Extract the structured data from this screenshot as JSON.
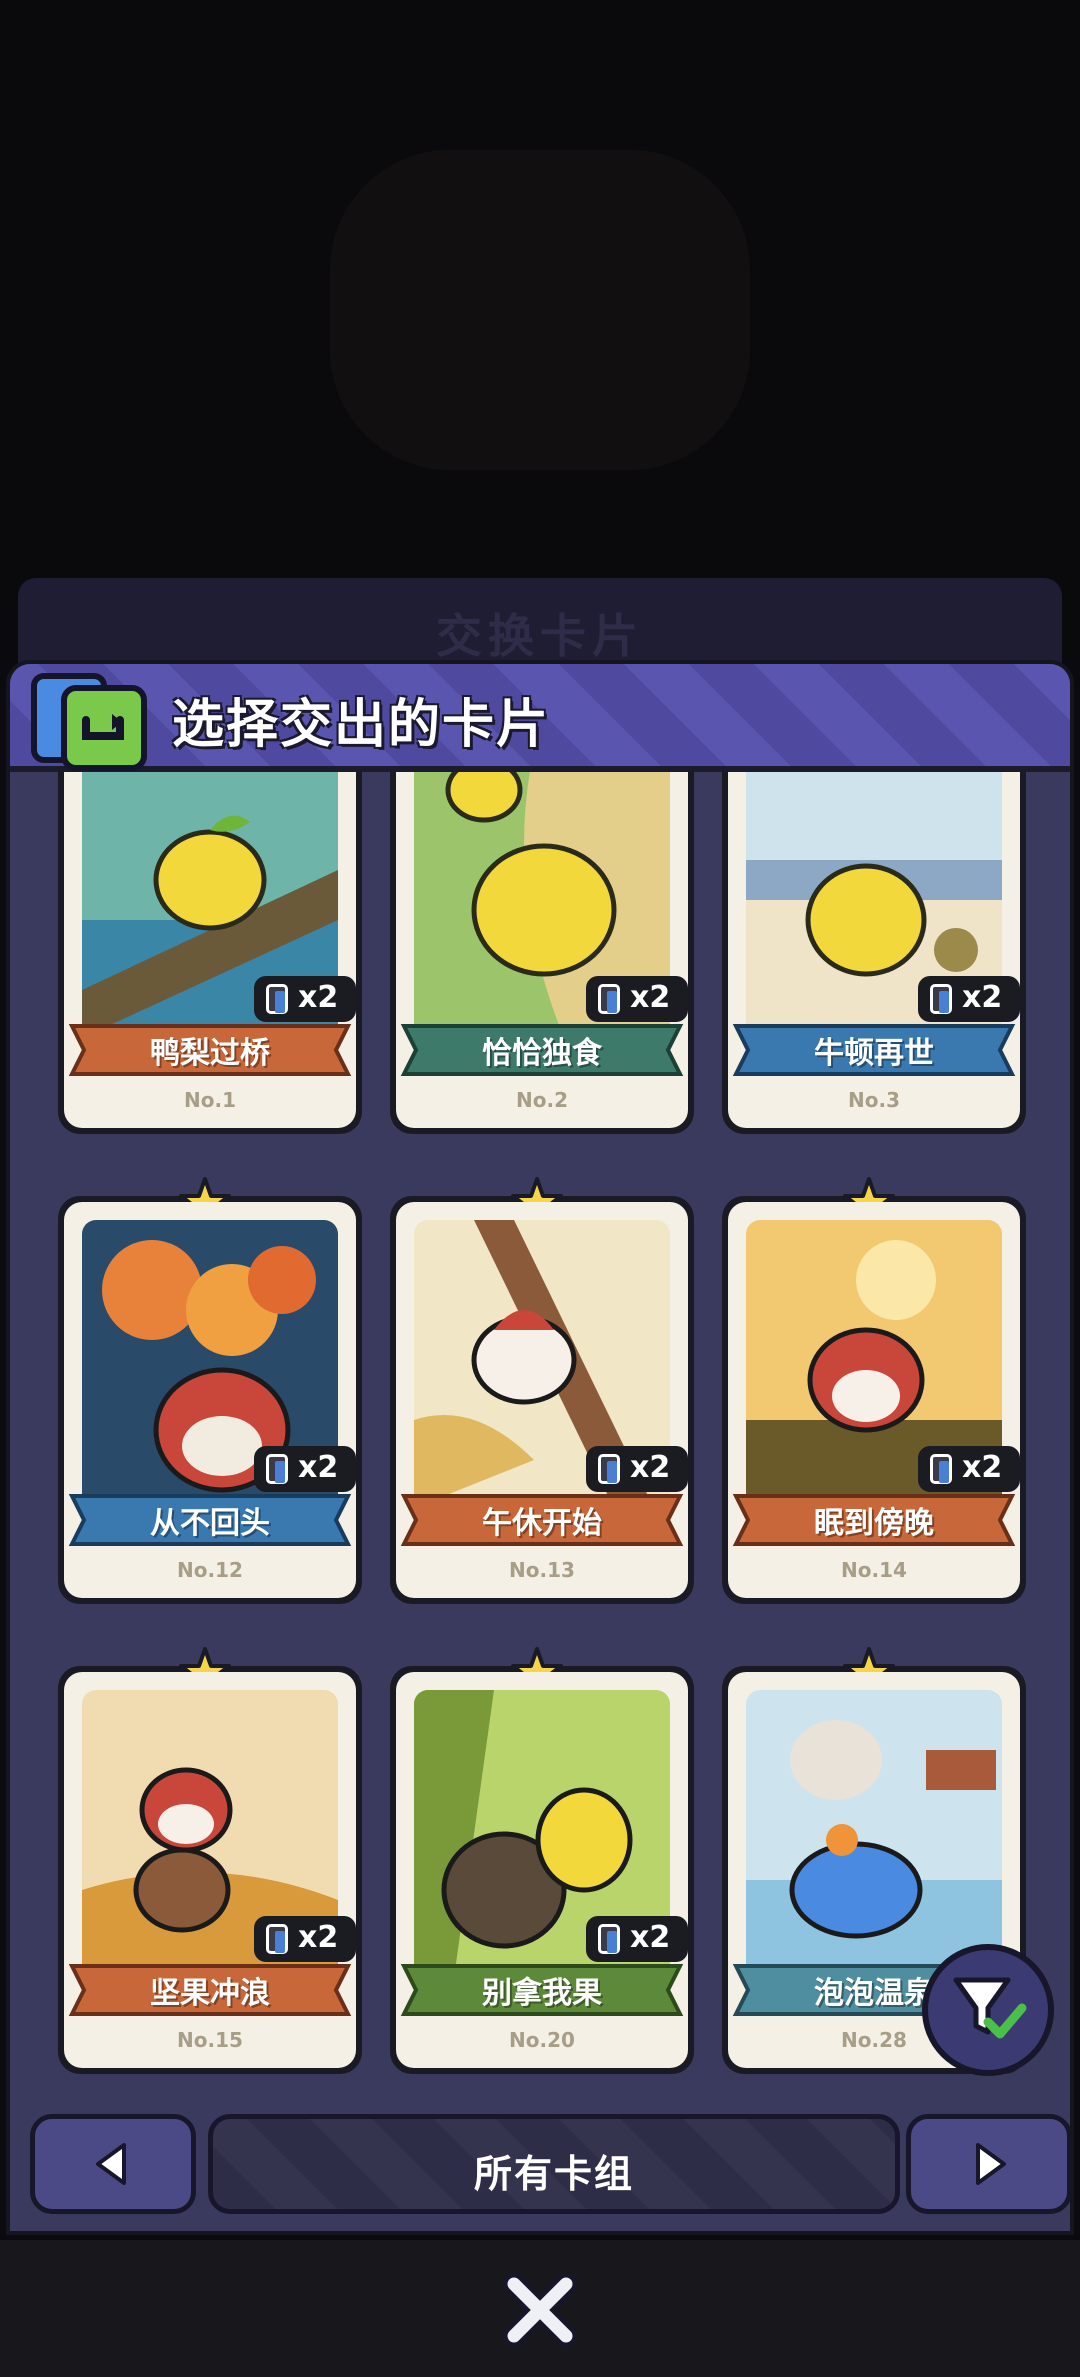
{
  "header": {
    "title": "选择交出的卡片",
    "icon": "swap-cards-icon"
  },
  "backdrop": {
    "ghost_title": "交换卡片"
  },
  "cards": [
    {
      "name": "鸭梨过桥",
      "number": "No.1",
      "count": "x2",
      "ribbon_color": "#c8683a",
      "rarity_star": false
    },
    {
      "name": "恰恰独食",
      "number": "No.2",
      "count": "x2",
      "ribbon_color": "#3d7a6a",
      "rarity_star": false
    },
    {
      "name": "牛顿再世",
      "number": "No.3",
      "count": "x2",
      "ribbon_color": "#3a78b0",
      "rarity_star": false
    },
    {
      "name": "从不回头",
      "number": "No.12",
      "count": "x2",
      "ribbon_color": "#3a78b0",
      "rarity_star": true
    },
    {
      "name": "午休开始",
      "number": "No.13",
      "count": "x2",
      "ribbon_color": "#c8683a",
      "rarity_star": true
    },
    {
      "name": "眠到傍晚",
      "number": "No.14",
      "count": "x2",
      "ribbon_color": "#c8683a",
      "rarity_star": true
    },
    {
      "name": "坚果冲浪",
      "number": "No.15",
      "count": "x2",
      "ribbon_color": "#c8683a",
      "rarity_star": true
    },
    {
      "name": "别拿我果",
      "number": "No.20",
      "count": "x2",
      "ribbon_color": "#5d8a3a",
      "rarity_star": true
    },
    {
      "name": "泡泡温泉",
      "number": "No.28",
      "count": "",
      "ribbon_color": "#4f8ea0",
      "rarity_star": true
    }
  ],
  "navigation": {
    "prev_icon": "arrow-left-icon",
    "next_icon": "arrow-right-icon",
    "deck_label": "所有卡组"
  },
  "filter": {
    "icon": "filter-check-icon"
  },
  "footer": {
    "close_icon": "close-icon"
  }
}
